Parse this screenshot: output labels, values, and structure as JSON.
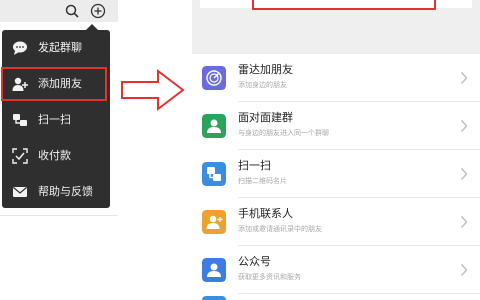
{
  "left_panel": {
    "menu": {
      "items": [
        {
          "label": "发起群聊",
          "icon": "chat-bubble-icon"
        },
        {
          "label": "添加朋友",
          "icon": "add-friend-icon"
        },
        {
          "label": "扫一扫",
          "icon": "scan-icon"
        },
        {
          "label": "收付款",
          "icon": "payment-icon"
        },
        {
          "label": "帮助与反馈",
          "icon": "mail-icon"
        }
      ],
      "highlighted_index": 1
    },
    "header_icons": [
      "search-icon",
      "plus-circle-icon"
    ]
  },
  "right_panel": {
    "rows": [
      {
        "title": "雷达加朋友",
        "subtitle": "添加身边的朋友",
        "icon": "radar-icon",
        "color": "#6b6bdc"
      },
      {
        "title": "面对面建群",
        "subtitle": "与身边的朋友进入同一个群聊",
        "icon": "group-icon",
        "color": "#2aa45c"
      },
      {
        "title": "扫一扫",
        "subtitle": "扫描二维码名片",
        "icon": "scan-icon",
        "color": "#3b8de0"
      },
      {
        "title": "手机联系人",
        "subtitle": "添加或邀请通讯录中的朋友",
        "icon": "phone-contact-icon",
        "color": "#f0a030"
      },
      {
        "title": "公众号",
        "subtitle": "获取更多资讯和服务",
        "icon": "official-account-icon",
        "color": "#3b7de0"
      }
    ]
  },
  "colors": {
    "highlight": "#e0342d",
    "menu_bg": "#2f2f2f"
  }
}
